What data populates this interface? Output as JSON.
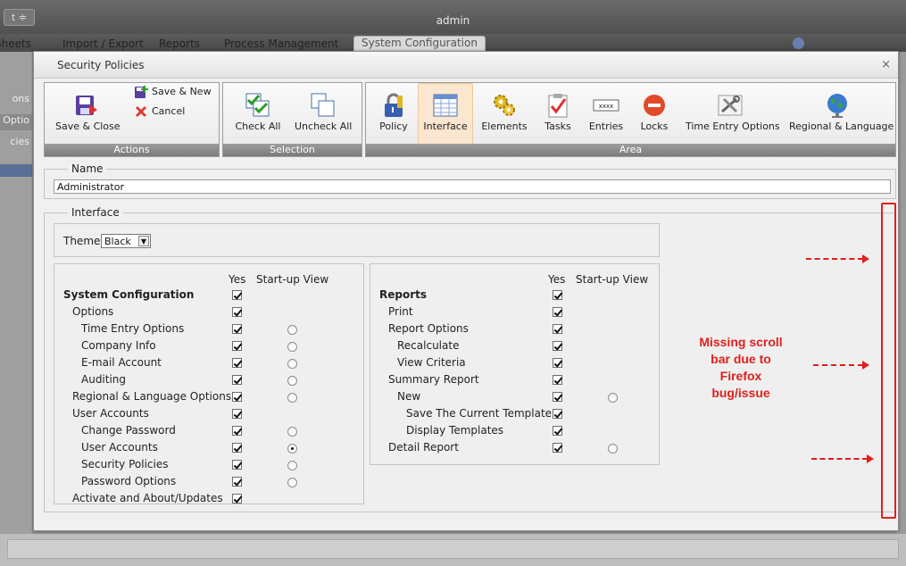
{
  "app": {
    "title": "admin",
    "menu_glyph": "t ≑",
    "tabs": [
      "Sheets",
      "Import / Export",
      "Reports",
      "Process Management",
      "System Configuration"
    ],
    "left_items": [
      "ons",
      "Optio",
      "cies"
    ]
  },
  "dialog": {
    "title": "Security Policies",
    "close_glyph": "×"
  },
  "toolbar": {
    "actions": {
      "footer": "Actions",
      "save_close": "Save & Close",
      "save_new": "Save & New",
      "cancel": "Cancel"
    },
    "selection": {
      "footer": "Selection",
      "check_all": "Check All",
      "uncheck_all": "Uncheck All"
    },
    "area": {
      "footer": "Area",
      "items": [
        "Policy",
        "Interface",
        "Elements",
        "Tasks",
        "Entries",
        "Locks",
        "Time Entry Options",
        "Regional & Language"
      ],
      "selected": "Interface"
    }
  },
  "name_section": {
    "legend": "Name",
    "value": "Administrator"
  },
  "interface_section": {
    "legend": "Interface",
    "theme_label": "Theme",
    "theme_value": "Black"
  },
  "columns": {
    "yes": "Yes",
    "startup": "Start-up View"
  },
  "left_panel": {
    "rows": [
      {
        "label": "System Configuration",
        "bold": true,
        "indent": 0,
        "yes": true,
        "radio": null
      },
      {
        "label": "Options",
        "bold": false,
        "indent": 1,
        "yes": true,
        "radio": null
      },
      {
        "label": "Time Entry Options",
        "bold": false,
        "indent": 2,
        "yes": true,
        "radio": "off"
      },
      {
        "label": "Company Info",
        "bold": false,
        "indent": 2,
        "yes": true,
        "radio": "off"
      },
      {
        "label": "E-mail Account",
        "bold": false,
        "indent": 2,
        "yes": true,
        "radio": "off"
      },
      {
        "label": "Auditing",
        "bold": false,
        "indent": 2,
        "yes": true,
        "radio": "off"
      },
      {
        "label": "Regional & Language Options",
        "bold": false,
        "indent": 1,
        "yes": true,
        "radio": "off"
      },
      {
        "label": "User Accounts",
        "bold": false,
        "indent": 1,
        "yes": true,
        "radio": null
      },
      {
        "label": "Change Password",
        "bold": false,
        "indent": 2,
        "yes": true,
        "radio": "off"
      },
      {
        "label": "User Accounts",
        "bold": false,
        "indent": 2,
        "yes": true,
        "radio": "on"
      },
      {
        "label": "Security Policies",
        "bold": false,
        "indent": 2,
        "yes": true,
        "radio": "off"
      },
      {
        "label": "Password Options",
        "bold": false,
        "indent": 2,
        "yes": true,
        "radio": "off"
      },
      {
        "label": "Activate and About/Updates",
        "bold": false,
        "indent": 1,
        "yes": true,
        "radio": null
      }
    ]
  },
  "right_panel": {
    "rows": [
      {
        "label": "Reports",
        "bold": true,
        "indent": 0,
        "yes": true,
        "radio": null
      },
      {
        "label": "Print",
        "bold": false,
        "indent": 1,
        "yes": true,
        "radio": null
      },
      {
        "label": "Report Options",
        "bold": false,
        "indent": 1,
        "yes": true,
        "radio": null
      },
      {
        "label": "Recalculate",
        "bold": false,
        "indent": 2,
        "yes": true,
        "radio": null
      },
      {
        "label": "View Criteria",
        "bold": false,
        "indent": 2,
        "yes": true,
        "radio": null
      },
      {
        "label": "Summary Report",
        "bold": false,
        "indent": 1,
        "yes": true,
        "radio": null
      },
      {
        "label": "New",
        "bold": false,
        "indent": 2,
        "yes": true,
        "radio": "off"
      },
      {
        "label": "Save The Current Template",
        "bold": false,
        "indent": 3,
        "yes": true,
        "radio": null
      },
      {
        "label": "Display Templates",
        "bold": false,
        "indent": 3,
        "yes": true,
        "radio": null
      },
      {
        "label": "Detail Report",
        "bold": false,
        "indent": 1,
        "yes": true,
        "radio": "off"
      }
    ]
  },
  "annotation": {
    "lines": [
      "Missing scroll",
      "bar due to",
      "Firefox",
      "bug/issue"
    ],
    "color": "#e0201c"
  }
}
